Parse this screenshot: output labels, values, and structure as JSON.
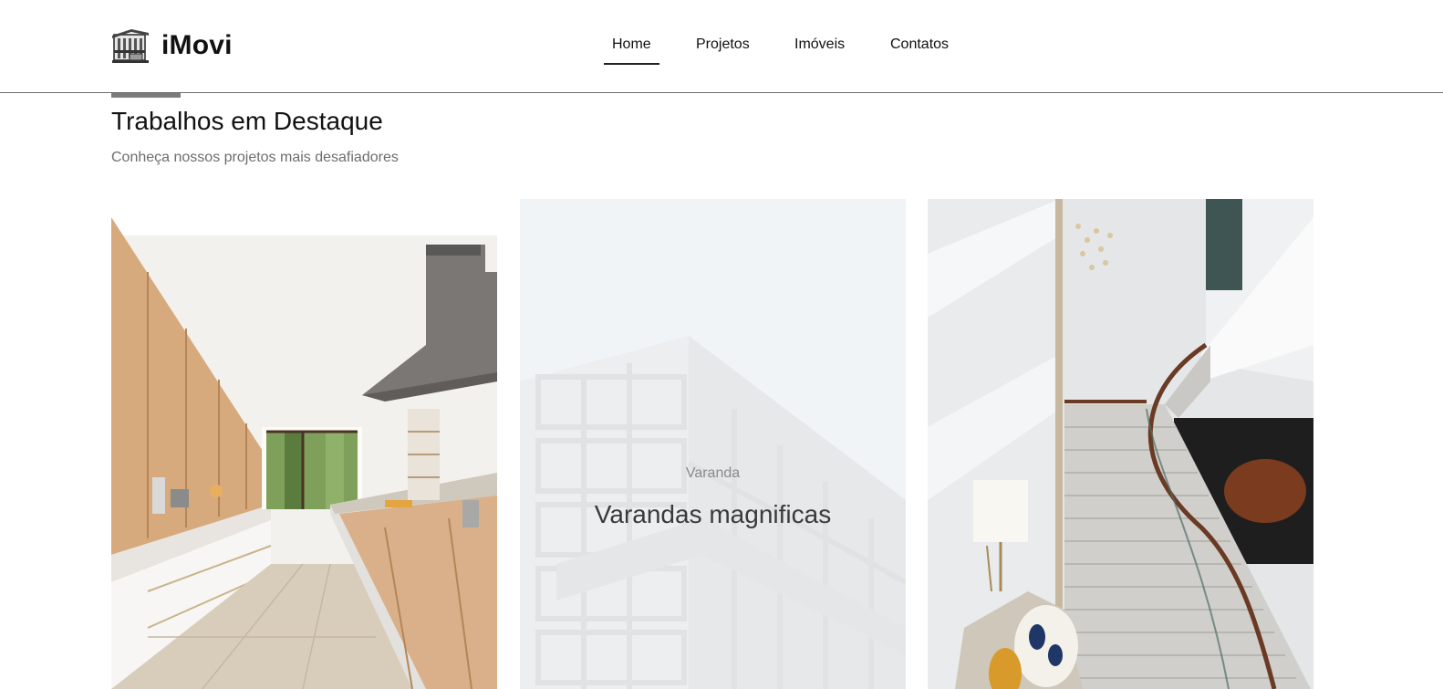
{
  "header": {
    "brand_name": "iMovi",
    "logo_icon": "building-icon",
    "nav": [
      {
        "label": "Home",
        "active": true
      },
      {
        "label": "Projetos",
        "active": false
      },
      {
        "label": "Imóveis",
        "active": false
      },
      {
        "label": "Contatos",
        "active": false
      }
    ]
  },
  "section": {
    "title": "Trabalhos em Destaque",
    "subtitle": "Conheça nossos projetos mais desafiadores"
  },
  "cards": [
    {
      "image": "kitchen-photo"
    },
    {
      "image": "building-facade-photo",
      "category": "Varanda",
      "title": "Varandas magnificas"
    },
    {
      "image": "staircase-lobby-photo"
    }
  ],
  "colors": {
    "text": "#111111",
    "muted": "#6d6d6d",
    "divider": "#6e6e6e",
    "accent_bar": "#7b7b7b"
  }
}
